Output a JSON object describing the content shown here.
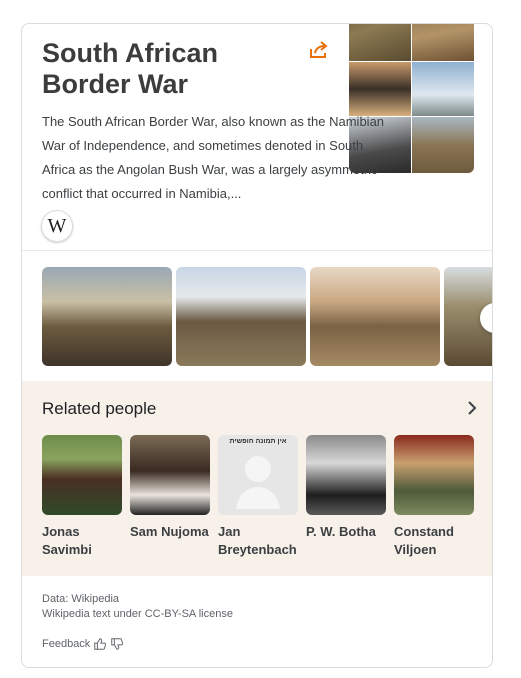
{
  "knowledge_panel": {
    "title": "South African Border War",
    "description": "The South African Border War, also known as the Namibian War of Independence, and sometimes denoted in South Africa as the Angolan Bush War, was a largely asymmetric conflict that occurred in Namibia,...",
    "source_icon": "wikipedia-icon",
    "source_letter": "W",
    "share_icon": "share-icon"
  },
  "related": {
    "heading": "Related people",
    "people": [
      {
        "name": "Jonas Savimbi"
      },
      {
        "name": "Sam Nujoma"
      },
      {
        "name": "Jan Breytenbach",
        "placeholder_text": "אין תמונה חופשית"
      },
      {
        "name": "P. W. Botha"
      },
      {
        "name": "Constand Viljoen"
      }
    ]
  },
  "footer": {
    "data_source": "Data: Wikipedia",
    "license": "Wikipedia text under CC-BY-SA license",
    "feedback": "Feedback"
  },
  "colors": {
    "accent": "#e8710a",
    "related_bg": "#f8f1ea"
  }
}
